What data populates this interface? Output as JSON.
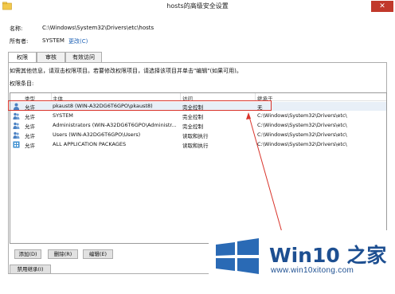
{
  "window": {
    "title": "hosts的高级安全设置",
    "close_glyph": "✕"
  },
  "fields": {
    "name_label": "名称:",
    "name_value": "C:\\Windows\\System32\\Drivers\\etc\\hosts",
    "owner_label": "所有者:",
    "owner_value": "SYSTEM",
    "change_link": "更改(C)"
  },
  "tabs": [
    {
      "label": "权限",
      "active": true
    },
    {
      "label": "审核",
      "active": false
    },
    {
      "label": "有效访问",
      "active": false
    }
  ],
  "info_text": "如需其他信息，请双击权限项目。若要修改权限项目，请选择该项目并单击\"编辑\"(如果可用)。",
  "entries_label": "权限条目:",
  "table": {
    "headers": [
      "类型",
      "主体",
      "访问",
      "继承于"
    ],
    "rows": [
      {
        "type": "允许",
        "principal": "pkaust8 (WIN-A32DG6T6GPO\\pkaust8)",
        "access": "完全控制",
        "inherited": "无",
        "icon": "user-icon",
        "selected": true
      },
      {
        "type": "允许",
        "principal": "SYSTEM",
        "access": "完全控制",
        "inherited": "C:\\Windows\\System32\\Drivers\\etc\\",
        "icon": "group-icon",
        "selected": false
      },
      {
        "type": "允许",
        "principal": "Administrators (WIN-A32DG6T6GPO\\Administr...",
        "access": "完全控制",
        "inherited": "C:\\Windows\\System32\\Drivers\\etc\\",
        "icon": "group-icon",
        "selected": false
      },
      {
        "type": "允许",
        "principal": "Users (WIN-A32DG6T6GPO\\Users)",
        "access": "读取和执行",
        "inherited": "C:\\Windows\\System32\\Drivers\\etc\\",
        "icon": "group-icon",
        "selected": false
      },
      {
        "type": "允许",
        "principal": "ALL APPLICATION PACKAGES",
        "access": "读取和执行",
        "inherited": "C:\\Windows\\System32\\Drivers\\etc\\",
        "icon": "package-icon",
        "selected": false
      }
    ]
  },
  "buttons": {
    "add": "添加(D)",
    "remove": "删除(R)",
    "edit": "编辑(E)",
    "disable_inheritance": "禁用继承(I)"
  },
  "watermark": {
    "title": "Win10 之家",
    "url": "www.win10xitong.com"
  },
  "colors": {
    "highlight": "#d9342b",
    "close_button": "#c1392b",
    "link": "#1a5fb4",
    "watermark": "#1d4f91"
  }
}
